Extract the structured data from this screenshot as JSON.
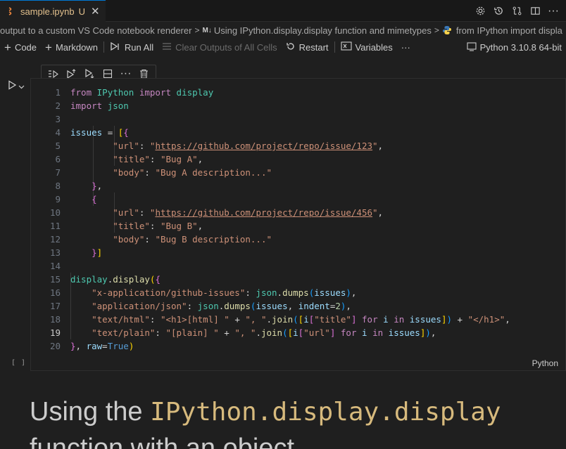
{
  "tab": {
    "filename": "sample.ipynb",
    "status": "U"
  },
  "breadcrumb": {
    "item1": "output to a custom VS Code notebook renderer",
    "item2_badge": "M↓",
    "item2": "Using IPython.display.display function and mimetypes",
    "item3": "from IPython import displa"
  },
  "toolbar": {
    "code": "Code",
    "markdown": "Markdown",
    "run_all": "Run All",
    "clear_outputs": "Clear Outputs of All Cells",
    "restart": "Restart",
    "variables": "Variables",
    "more": "···",
    "kernel": "Python 3.10.8 64-bit"
  },
  "cell": {
    "exec_count": "[ ]",
    "language": "Python",
    "line_numbers": [
      "1",
      "2",
      "3",
      "4",
      "5",
      "6",
      "7",
      "8",
      "9",
      "10",
      "11",
      "12",
      "13",
      "14",
      "15",
      "16",
      "17",
      "18",
      "19",
      "20"
    ]
  },
  "markdown": {
    "heading_prefix": "Using the ",
    "heading_code": "IPython.display.display",
    "heading_line2": "function with an object"
  }
}
